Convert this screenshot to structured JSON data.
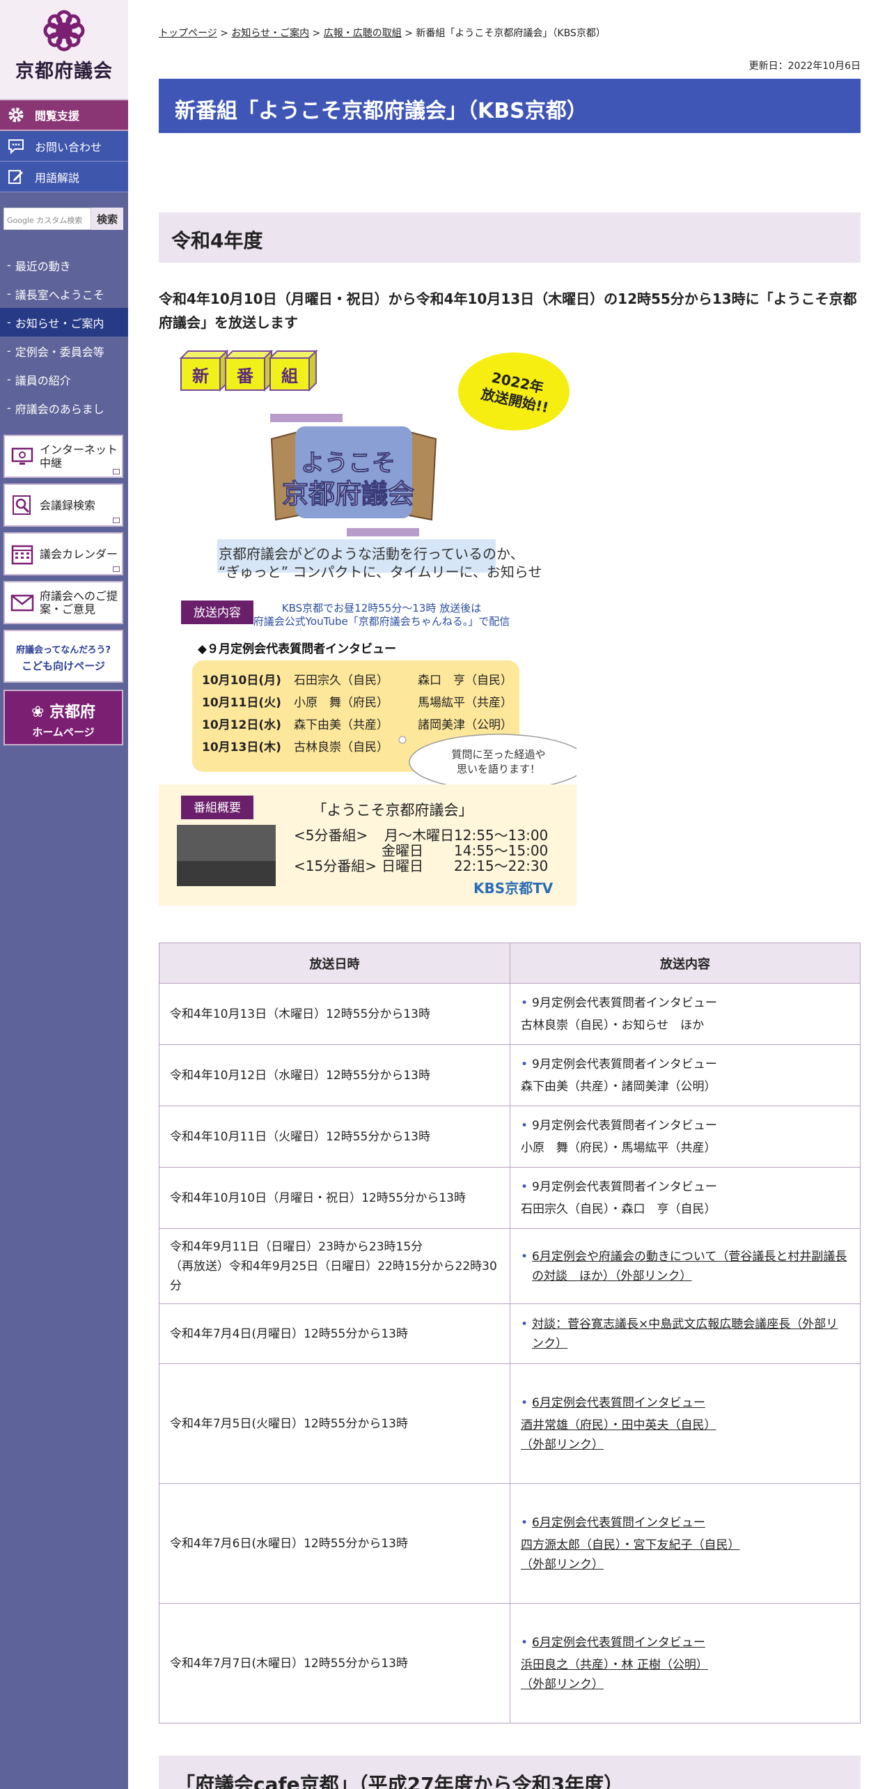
{
  "sidebar": {
    "logo_text": "京都府議会",
    "top_buttons": [
      "閲覧支援",
      "お問い合わせ",
      "用語解説"
    ],
    "search": {
      "placeholder": "Google カスタム検索",
      "button": "検索"
    },
    "nav": [
      "最近の動き",
      "議長室へようこそ",
      "お知らせ・ご案内",
      "定例会・委員会等",
      "議員の紹介",
      "府議会のあらまし"
    ],
    "links": [
      "インターネット中継",
      "会議録検索",
      "議会カレンダー",
      "府議会へのご提案・ご意見"
    ],
    "kids": {
      "line1": "府議会ってなんだろう?",
      "line2": "こども向けページ"
    },
    "pref": {
      "line1": "京都府",
      "line2": "ホームページ"
    }
  },
  "breadcrumb": {
    "items": [
      "トップページ",
      "お知らせ・ご案内",
      "広報・広聴の取組"
    ],
    "current": "新番組「ようこそ京都府議会」（KBS京都）"
  },
  "updated": "更新日：2022年10月6日",
  "page_title": "新番組「ようこそ京都府議会」（KBS京都）",
  "section_heading": "令和4年度",
  "lead": "令和4年10月10日（月曜日・祝日）から令和4年10月13日（木曜日）の12時55分から13時に「ようこそ京都府議会」を放送します",
  "banner": {
    "blocks": [
      "新",
      "番",
      "組"
    ],
    "balloon": [
      "2022年",
      "放送開始!!"
    ],
    "logo_small": "ようこそ",
    "logo_big": "京都府議会",
    "desc1": "京都府議会がどのような活動を行っているのか、",
    "desc2": "“ぎゅっと” コンパクトに、タイムリーに、お知らせ",
    "label_content": "放送内容",
    "kbs_note1": "KBS京都でお昼12時55分～13時 放送後は",
    "kbs_note2": "府議会公式YouTube「京都府議会ちゃんねる。」で配信",
    "interview_title": "◆９月定例会代表質問者インタビュー",
    "interviews": [
      {
        "date": "10月10日(月)",
        "a": "石田宗久（自民）",
        "b": "森口　亨（自民）"
      },
      {
        "date": "10月11日(火)",
        "a": "小原　舞（府民）",
        "b": "馬場紘平（共産）"
      },
      {
        "date": "10月12日(水)",
        "a": "森下由美（共産）",
        "b": "諸岡美津（公明）"
      },
      {
        "date": "10月13日(木)",
        "a": "古林良崇（自民）",
        "b": ""
      }
    ],
    "bubble": [
      "質問に至った経過や",
      "思いを語ります！"
    ],
    "label_summary": "番組概要",
    "program_name": "「ようこそ京都府議会」",
    "sched_5": "<5分番組>",
    "sched_5a_day": "月～木曜日",
    "sched_5a_time": "12:55～13:00",
    "sched_5b_day": "金曜日",
    "sched_5b_time": "14:55～15:00",
    "sched_15": "<15分番組>",
    "sched_15_day": "日曜日",
    "sched_15_time": "22:15～22:30",
    "kbs_logo": "KBS京都TV"
  },
  "table": {
    "headers": [
      "放送日時",
      "放送内容"
    ],
    "rows": [
      {
        "date": "令和4年10月13日（木曜日）12時55分から13時",
        "title": "9月定例会代表質問者インタビュー",
        "detail": "古林良崇（自民）・お知らせ　ほか",
        "link": false
      },
      {
        "date": "令和4年10月12日（水曜日）12時55分から13時",
        "title": "9月定例会代表質問者インタビュー",
        "detail": "森下由美（共産）・諸岡美津（公明）",
        "link": false
      },
      {
        "date": "令和4年10月11日（火曜日）12時55分から13時",
        "title": "9月定例会代表質問者インタビュー",
        "detail": "小原　舞（府民）・馬場紘平（共産）",
        "link": false
      },
      {
        "date": "令和4年10月10日（月曜日・祝日）12時55分から13時",
        "title": "9月定例会代表質問者インタビュー",
        "detail": "石田宗久（自民）・森口　亨（自民）",
        "link": false
      },
      {
        "date": "令和4年9月11日（日曜日）23時から23時15分\n（再放送）令和4年9月25日（日曜日）22時15分から22時30分",
        "title": "6月定例会や府議会の動きについて（菅谷議長と村井副議長の対談　ほか）（外部リンク）",
        "detail": "",
        "link": true
      },
      {
        "date": "令和4年7月4日(月曜日）12時55分から13時",
        "title": "対談：菅谷寛志議長×中島武文広報広聴会議座長（外部リンク）",
        "detail": "",
        "link": true
      },
      {
        "date": "令和4年7月5日(火曜日）12時55分から13時",
        "title": "6月定例会代表質問インタビュー",
        "detail": "酒井常雄（府民）・田中英夫（自民）\n（外部リンク）",
        "link": true
      },
      {
        "date": "令和4年7月6日(水曜日）12時55分から13時",
        "title": "6月定例会代表質問インタビュー",
        "detail": "四方源太郎（自民）・宮下友紀子（自民）\n（外部リンク）",
        "link": true
      },
      {
        "date": "令和4年7月7日(木曜日）12時55分から13時",
        "title": "6月定例会代表質問インタビュー",
        "detail": "浜田良之（共産）・林 正樹（公明）\n（外部リンク）",
        "link": true
      }
    ]
  },
  "section_heading_2": "「府議会cafe京都」（平成27年度から令和3年度）",
  "colors": {
    "sidebar": "#5e6499",
    "accent_purple": "#7b1f73",
    "title_blue": "#3f56b7",
    "heading_bg": "#ece4ee"
  }
}
